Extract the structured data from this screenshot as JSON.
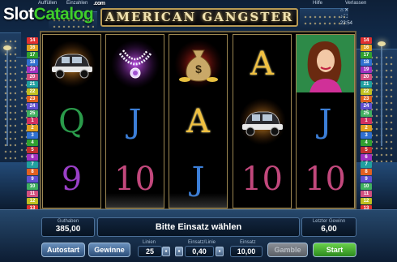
{
  "topbar": {
    "auffullen": "Auffüllen",
    "einzahlen": "Einzahlen",
    "hilfe": "Hilfe",
    "verlassen": "Verlassen",
    "time": "23:54"
  },
  "logo": {
    "slot": "Slot",
    "catalog": "Catalog",
    "tld": ".com"
  },
  "game": {
    "title": "AMERICAN GANGSTER"
  },
  "paylines_left": [
    "14",
    "16",
    "17",
    "18",
    "19",
    "20",
    "21",
    "22",
    "23",
    "24",
    "25",
    "1",
    "2",
    "3",
    "4",
    "5",
    "6",
    "7",
    "8",
    "9",
    "10",
    "11",
    "12",
    "13"
  ],
  "paylines_right": [
    "14",
    "16",
    "17",
    "18",
    "19",
    "20",
    "21",
    "22",
    "23",
    "24",
    "25",
    "1",
    "2",
    "3",
    "4",
    "5",
    "6",
    "7",
    "8",
    "9",
    "10",
    "11",
    "12",
    "13"
  ],
  "payline_colors": [
    "#e03030",
    "#e0a020",
    "#30a030",
    "#3070d0",
    "#a030c0",
    "#d05080",
    "#20a0a0",
    "#c0c020",
    "#e06020",
    "#6050d0",
    "#40b060",
    "#d03060",
    "#e0a020",
    "#3070d0",
    "#30a030",
    "#c03030",
    "#a030c0",
    "#20a0a0",
    "#e06020",
    "#6050d0",
    "#40b060",
    "#d05080",
    "#c0c020",
    "#e03030"
  ],
  "reels": [
    [
      {
        "type": "icon",
        "name": "car-icon"
      },
      {
        "type": "letter",
        "value": "Q",
        "color": "green"
      },
      {
        "type": "letter",
        "value": "9",
        "color": "purple"
      }
    ],
    [
      {
        "type": "icon",
        "name": "necklace-icon"
      },
      {
        "type": "letter",
        "value": "J",
        "color": "blue"
      },
      {
        "type": "letter",
        "value": "10",
        "color": "pink"
      }
    ],
    [
      {
        "type": "icon",
        "name": "money-bag-icon"
      },
      {
        "type": "letter",
        "value": "A",
        "color": "gold"
      },
      {
        "type": "letter",
        "value": "J",
        "color": "blue"
      }
    ],
    [
      {
        "type": "letter",
        "value": "A",
        "color": "gold"
      },
      {
        "type": "icon",
        "name": "car-icon"
      },
      {
        "type": "letter",
        "value": "10",
        "color": "pink"
      }
    ],
    [
      {
        "type": "icon",
        "name": "woman-icon"
      },
      {
        "type": "letter",
        "value": "J",
        "color": "blue"
      },
      {
        "type": "letter",
        "value": "10",
        "color": "pink"
      }
    ]
  ],
  "panel": {
    "guthaben_label": "Guthaben",
    "guthaben_value": "385,00",
    "message": "Bitte Einsatz wählen",
    "letzter_gewinn_label": "Letzter Gewinn",
    "letzter_gewinn_value": "6,00",
    "autostart": "Autostart",
    "gewinne": "Gewinne",
    "linien_label": "Linien",
    "linien_value": "25",
    "einsatz_linie_label": "Einsatz/Linie",
    "einsatz_linie_value": "0,40",
    "einsatz_label": "Einsatz",
    "einsatz_value": "10,00",
    "gamble": "Gamble",
    "start": "Start"
  }
}
